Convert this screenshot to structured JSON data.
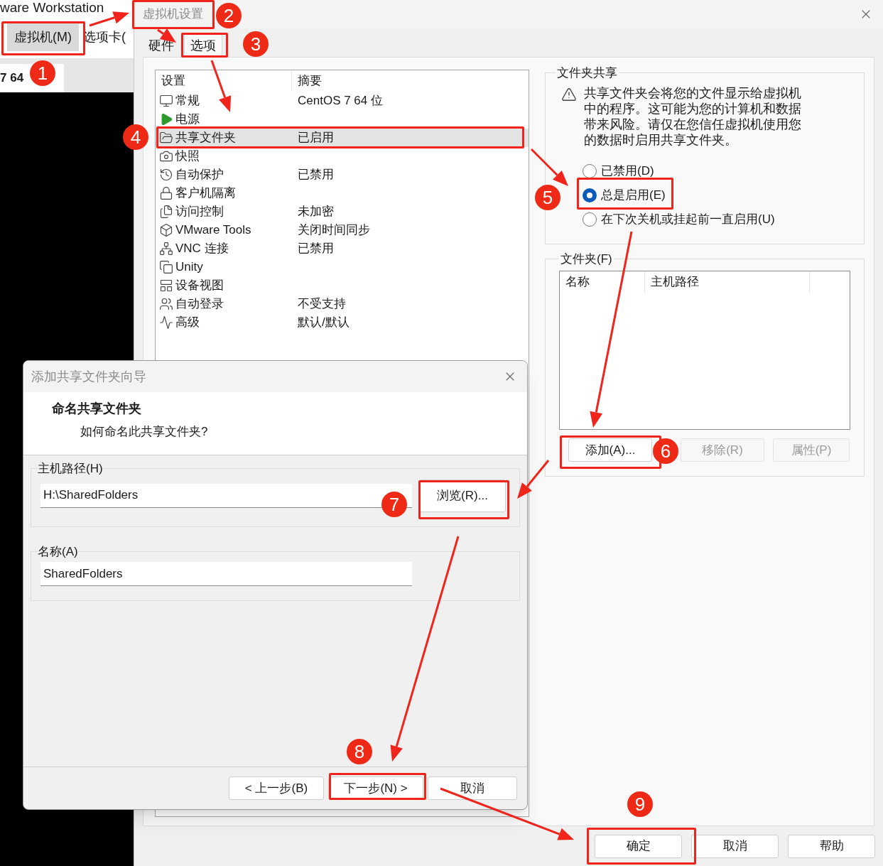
{
  "background_app": {
    "title": "ware Workstation",
    "menu": [
      {
        "label": "虚拟机(M)",
        "selected": true
      },
      {
        "label": "选项卡(",
        "selected": false
      }
    ],
    "tab": "7 64"
  },
  "settings_window": {
    "title": "虚拟机设置",
    "tabs": [
      {
        "label": "硬件",
        "selected": false
      },
      {
        "label": "选项",
        "selected": true
      }
    ],
    "list": {
      "columns": [
        "设置",
        "摘要"
      ],
      "rows": [
        {
          "setting": "常规",
          "summary": "CentOS 7 64 位",
          "selected": false
        },
        {
          "setting": "电源",
          "selected": false
        },
        {
          "setting": "共享文件夹",
          "summary": "已启用",
          "selected": true
        },
        {
          "setting": "快照",
          "selected": false
        },
        {
          "setting": "自动保护",
          "summary": "已禁用",
          "selected": false
        },
        {
          "setting": "客户机隔离",
          "selected": false
        },
        {
          "setting": "访问控制",
          "summary": "未加密",
          "selected": false
        },
        {
          "setting": "VMware Tools",
          "summary": "关闭时间同步",
          "selected": false
        },
        {
          "setting": "VNC 连接",
          "summary": "已禁用",
          "selected": false
        },
        {
          "setting": "Unity",
          "selected": false
        },
        {
          "setting": "设备视图",
          "selected": false
        },
        {
          "setting": "自动登录",
          "summary": "不受支持",
          "selected": false
        },
        {
          "setting": "高级",
          "summary": "默认/默认",
          "selected": false
        }
      ]
    },
    "folder_sharing": {
      "title": "文件夹共享",
      "warning": "共享文件夹会将您的文件显示给虚拟机中的程序。这可能为您的计算机和数据带来风险。请仅在您信任虚拟机使用您的数据时启用共享文件夹。",
      "options": [
        {
          "label": "已禁用(D)",
          "selected": false
        },
        {
          "label": "总是启用(E)",
          "selected": true
        },
        {
          "label": "在下次关机或挂起前一直启用(U)",
          "selected": false
        }
      ]
    },
    "folders": {
      "title": "文件夹(F)",
      "columns": [
        "名称",
        "主机路径"
      ],
      "buttons": [
        {
          "label": "添加(A)...",
          "disabled": false
        },
        {
          "label": "移除(R)",
          "disabled": true
        },
        {
          "label": "属性(P)",
          "disabled": true
        }
      ]
    },
    "buttons": [
      "确定",
      "取消",
      "帮助"
    ]
  },
  "wizard": {
    "title": "添加共享文件夹向导",
    "heading": "命名共享文件夹",
    "subheading": "如何命名此共享文件夹?",
    "groups": [
      {
        "label": "主机路径(H)",
        "value": "H:\\SharedFolders",
        "button": "浏览(R)..."
      },
      {
        "label": "名称(A)",
        "value": "SharedFolders"
      }
    ],
    "buttons": [
      "< 上一步(B)",
      "下一步(N) >",
      "取消"
    ]
  },
  "annotations": {
    "steps": [
      "1",
      "2",
      "3",
      "4",
      "5",
      "6",
      "7",
      "8",
      "9"
    ]
  }
}
